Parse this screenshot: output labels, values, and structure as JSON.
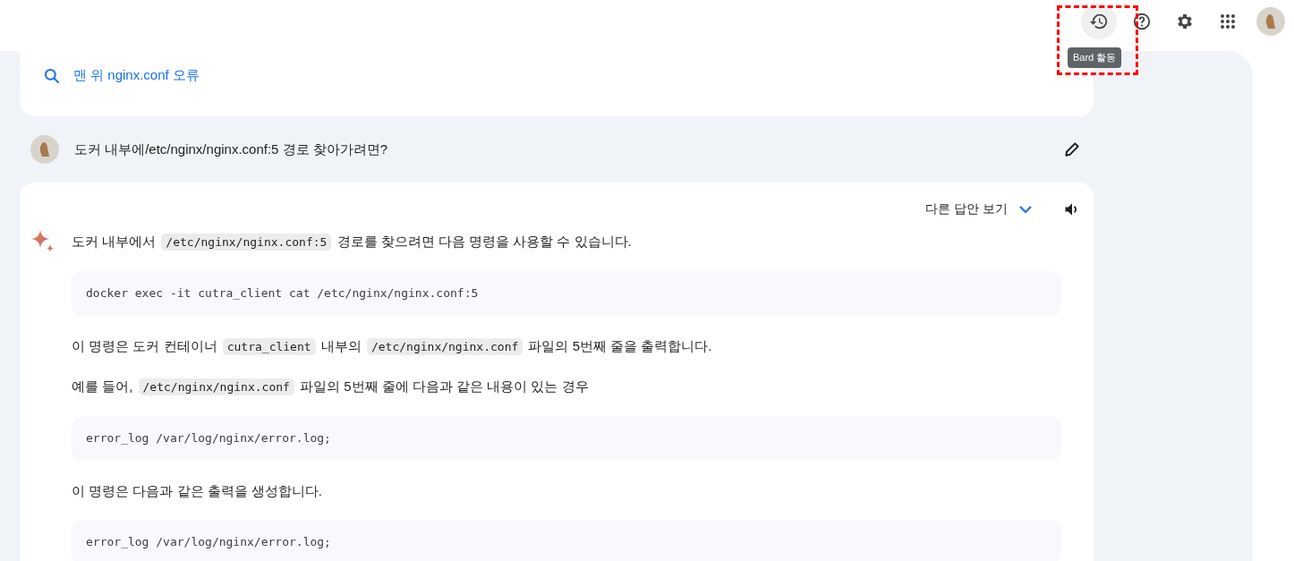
{
  "top_bar": {
    "icons": [
      {
        "kind": "history",
        "hovered": true
      },
      {
        "kind": "help",
        "hovered": false
      },
      {
        "kind": "settings",
        "hovered": false
      },
      {
        "kind": "apps",
        "hovered": false
      },
      {
        "kind": "avatar",
        "hovered": false
      }
    ],
    "tooltip": "Bard 활동",
    "highlight": true
  },
  "search": {
    "text": "맨 위 nginx.conf 오류"
  },
  "query": {
    "text": "도커 내부에/etc/nginx/nginx.conf:5   경로 찾아가려면?"
  },
  "response": {
    "other_drafts": "다른 답안 보기",
    "blocks": [
      {
        "kind": "paragraph",
        "parts": [
          {
            "kind": "text",
            "text": "도커 내부에서 "
          },
          {
            "kind": "code",
            "text": "/etc/nginx/nginx.conf:5"
          },
          {
            "kind": "text",
            "text": " 경로를 찾으려면 다음 명령을 사용할 수 있습니다."
          }
        ]
      },
      {
        "kind": "codeblock",
        "text": "docker exec -it cutra_client cat /etc/nginx/nginx.conf:5"
      },
      {
        "kind": "paragraph",
        "parts": [
          {
            "kind": "text",
            "text": "이 명령은 도커 컨테이너 "
          },
          {
            "kind": "code",
            "text": "cutra_client"
          },
          {
            "kind": "text",
            "text": " 내부의 "
          },
          {
            "kind": "code",
            "text": "/etc/nginx/nginx.conf"
          },
          {
            "kind": "text",
            "text": " 파일의 5번째 줄을 출력합니다."
          }
        ]
      },
      {
        "kind": "paragraph",
        "parts": [
          {
            "kind": "text",
            "text": "예를 들어, "
          },
          {
            "kind": "code",
            "text": "/etc/nginx/nginx.conf"
          },
          {
            "kind": "text",
            "text": " 파일의 5번째 줄에 다음과 같은 내용이 있는 경우"
          }
        ]
      },
      {
        "kind": "codeblock",
        "text": "error_log /var/log/nginx/error.log;"
      },
      {
        "kind": "paragraph",
        "parts": [
          {
            "kind": "text",
            "text": "이 명령은 다음과 같은 출력을 생성합니다."
          }
        ]
      },
      {
        "kind": "codeblock",
        "text": "error_log /var/log/nginx/error.log;"
      }
    ]
  }
}
